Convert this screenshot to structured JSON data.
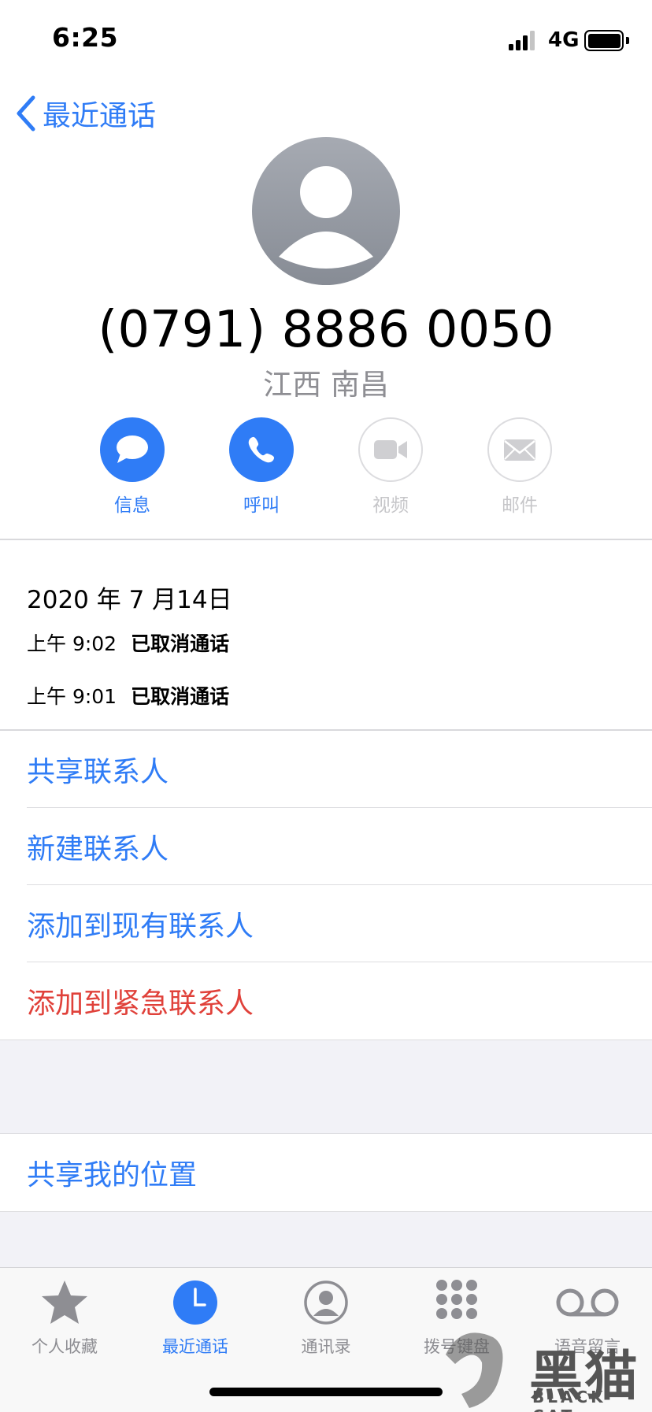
{
  "status_bar": {
    "time": "6:25",
    "network": "4G",
    "battery_level": 0.9,
    "signal_bars": 3
  },
  "nav": {
    "back_label": "最近通话"
  },
  "contact": {
    "phone_number": "(0791) 8886 0050",
    "location": "江西 南昌"
  },
  "actions": [
    {
      "label": "信息",
      "icon": "message-icon",
      "enabled": true
    },
    {
      "label": "呼叫",
      "icon": "phone-icon",
      "enabled": true
    },
    {
      "label": "视频",
      "icon": "video-icon",
      "enabled": false
    },
    {
      "label": "邮件",
      "icon": "mail-icon",
      "enabled": false
    }
  ],
  "call_history": {
    "date": "2020 年 7 月14日",
    "entries": [
      {
        "time": "上午 9:02",
        "status": "已取消通话"
      },
      {
        "time": "上午 9:01",
        "status": "已取消通话"
      }
    ]
  },
  "options": {
    "share_contact": "共享联系人",
    "new_contact": "新建联系人",
    "add_existing": "添加到现有联系人",
    "add_emergency": "添加到紧急联系人",
    "share_location": "共享我的位置"
  },
  "tabs": [
    {
      "label": "个人收藏",
      "icon": "star-icon",
      "active": false
    },
    {
      "label": "最近通话",
      "icon": "clock-icon",
      "active": true
    },
    {
      "label": "通讯录",
      "icon": "contacts-icon",
      "active": false
    },
    {
      "label": "拨号键盘",
      "icon": "keypad-icon",
      "active": false
    },
    {
      "label": "语音留言",
      "icon": "voicemail-icon",
      "active": false
    }
  ],
  "watermark": {
    "text": "黑猫",
    "subtext": "BLACK CAT"
  },
  "colors": {
    "accent": "#2f7cf6",
    "destructive": "#e0413a",
    "secondary_text": "#8e8e93",
    "grouped_background": "#f2f2f7"
  }
}
